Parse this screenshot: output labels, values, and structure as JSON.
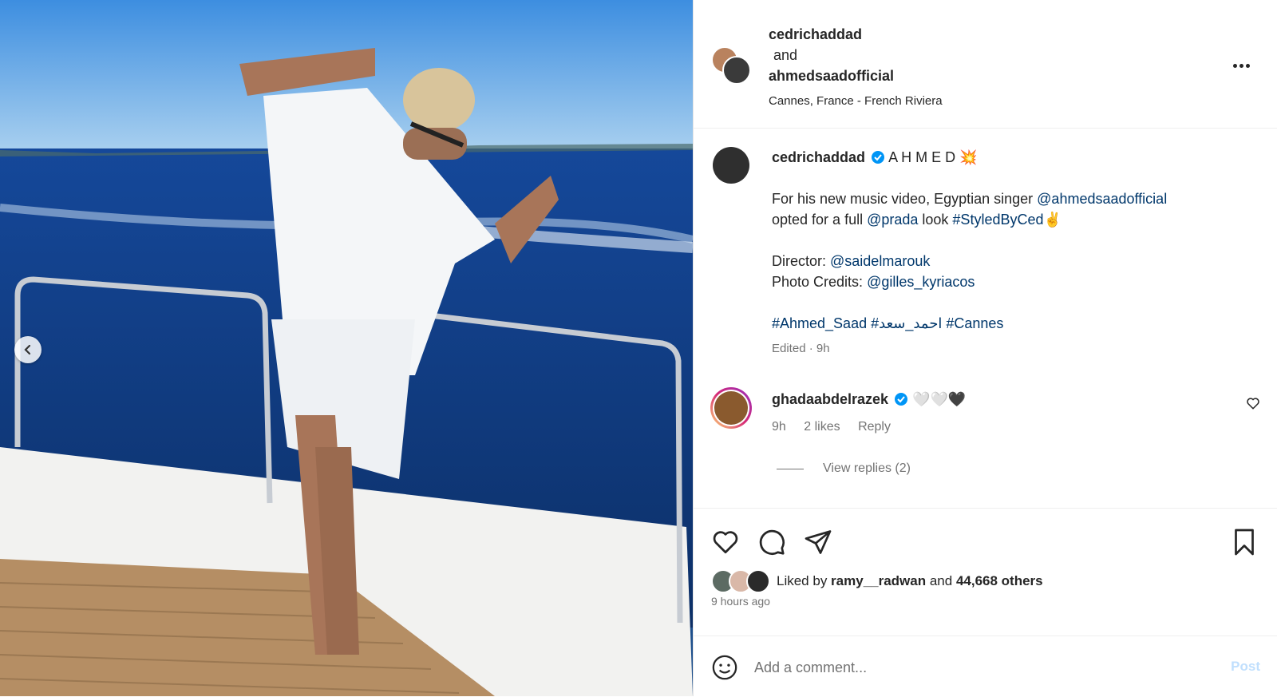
{
  "header": {
    "user1": "cedrichaddad",
    "and_text": "and",
    "user2": "ahmedsaadofficial",
    "location": "Cannes, France - French Riviera",
    "more_icon": "more-horizontal-icon"
  },
  "caption": {
    "username": "cedrichaddad",
    "title": "A H M E D",
    "title_emoji": "💥",
    "line1_prefix": "For his new music video, Egyptian singer ",
    "line1_mention": "@ahmedsaadofficial",
    "line2_prefix": "opted for a full ",
    "line2_mention": "@prada",
    "line2_mid": " look ",
    "line2_tag": "#StyledByCed",
    "line2_emoji": "✌️",
    "director_label": "Director: ",
    "director_mention": "@saidelmarouk",
    "credits_label": "Photo Credits: ",
    "credits_mention": "@gilles_kyriacos",
    "tag1": "#Ahmed_Saad",
    "tag2": "#احمد_سعد",
    "tag3": "#Cannes",
    "edited": "Edited · 9h"
  },
  "comment": {
    "username": "ghadaabdelrazek",
    "text": "🤍🤍🖤",
    "time": "9h",
    "likes": "2 likes",
    "reply": "Reply",
    "view_replies": "View replies (2)"
  },
  "actions": {
    "liked_by_prefix": "Liked by ",
    "liked_by_user": "ramy__radwan",
    "liked_by_and": " and ",
    "liked_by_others": "44,668 others",
    "time_ago": "9 hours ago"
  },
  "comment_bar": {
    "placeholder": "Add a comment...",
    "post_label": "Post"
  },
  "colors": {
    "link": "#00376b",
    "verified": "#0095f6",
    "muted": "#737373",
    "post_disabled": "#c0dffd"
  }
}
